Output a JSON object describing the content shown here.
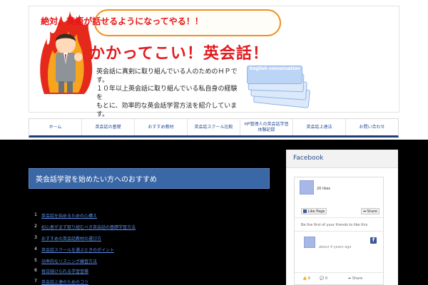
{
  "banner": {
    "slogan": "絶対、英語が話せるようになってやる！！",
    "site_title": "かかってこい！英会話！",
    "description": [
      "英会話に真剣に取り組んでいる人のためのＨＰです。",
      "１０年以上英会話に取り組んでいる私自身の経験を",
      "もとに、効率的な英会話学習方法を紹介しています。"
    ],
    "card_label": "English conversation"
  },
  "nav": {
    "items": [
      "ホーム",
      "英会話の基礎",
      "おすすめ教材",
      "英会話スクール比較",
      "HP管理人の英会話学習体験記録",
      "英会話上達法",
      "お問い合わせ"
    ]
  },
  "post": {
    "title": "英会話学習を始めたい方へのおすすめ",
    "list": [
      {
        "num": "1",
        "text": "英会話を始めるための心構え"
      },
      {
        "num": "2",
        "text": "初心者がまず取り組むべき英会話の基礎学習方法"
      },
      {
        "num": "3",
        "text": "おすすめの英会話教材の選び方"
      },
      {
        "num": "4",
        "text": "英会話スクールを選ぶときのポイント"
      },
      {
        "num": "5",
        "text": "効率的なリスニング練習方法"
      },
      {
        "num": "6",
        "text": "毎日続けられる学習習慣"
      },
      {
        "num": "7",
        "text": "英会話上達のためのコツ"
      }
    ]
  },
  "sidebar": {
    "heading": "Facebook",
    "fb": {
      "likes": "20 likes",
      "like_button": "Like Page",
      "share_button": "Share",
      "first_friends": "Be the first of your friends to like this",
      "post_time": "about 4 years ago",
      "like_count": "0",
      "comment_count": "0",
      "share_label": "Share"
    }
  },
  "colors": {
    "accent_red": "#e2191d",
    "nav_blue": "#1e3c78",
    "title_blue": "#3a67a5",
    "link_blue": "#5b8ee8",
    "facebook_blue": "#3b5998"
  }
}
